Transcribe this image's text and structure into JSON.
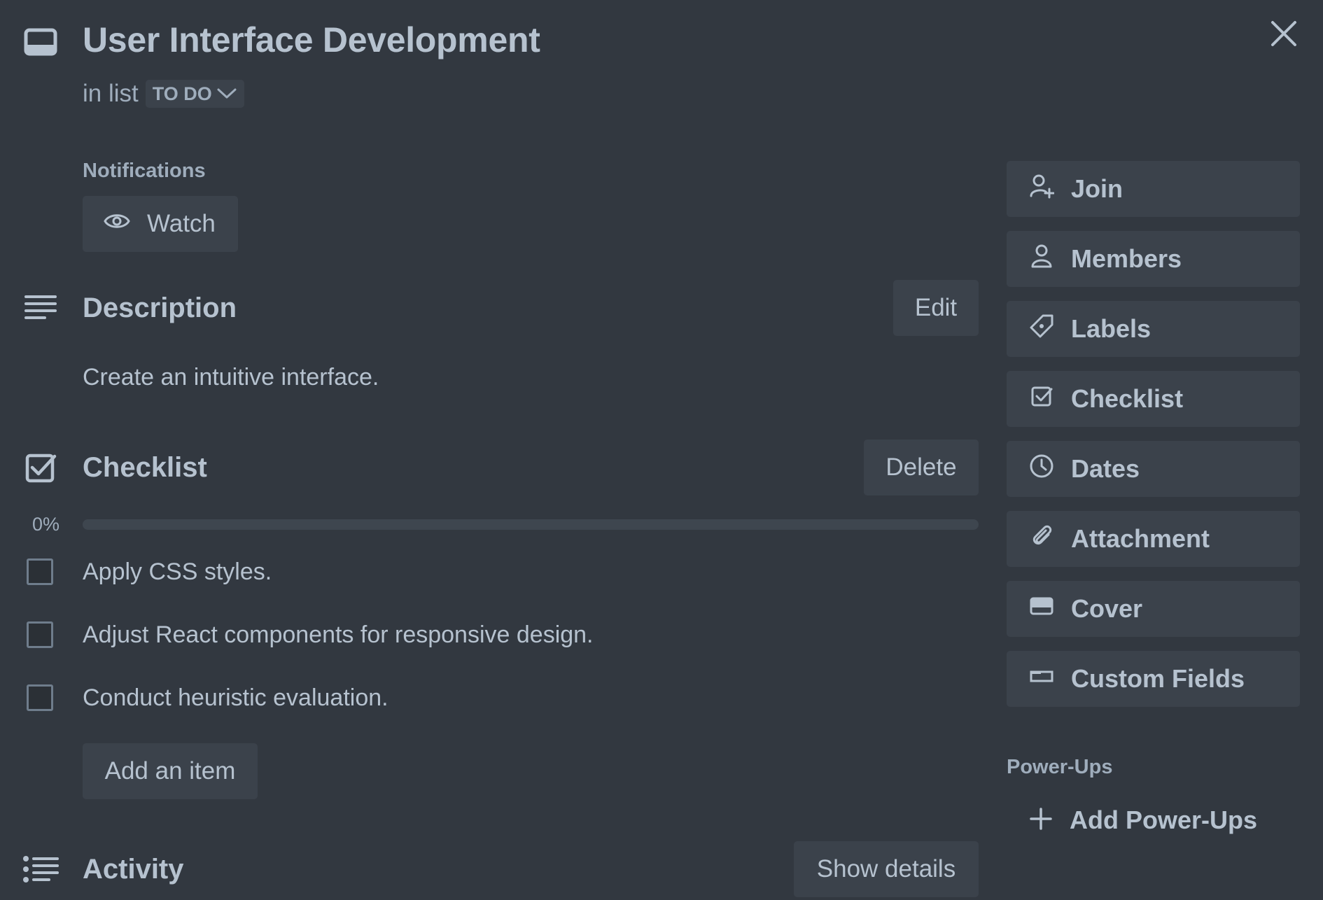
{
  "card": {
    "title": "User Interface Development",
    "in_list_prefix": "in list",
    "list_name": "TO DO"
  },
  "notifications": {
    "label": "Notifications",
    "watch_label": "Watch"
  },
  "description": {
    "title": "Description",
    "edit_label": "Edit",
    "text": "Create an intuitive interface."
  },
  "checklist": {
    "title": "Checklist",
    "delete_label": "Delete",
    "progress_text": "0%",
    "progress": 0,
    "items": [
      {
        "text": "Apply CSS styles.",
        "checked": false
      },
      {
        "text": "Adjust React components for responsive design.",
        "checked": false
      },
      {
        "text": "Conduct heuristic evaluation.",
        "checked": false
      }
    ],
    "add_item_label": "Add an item"
  },
  "activity": {
    "title": "Activity",
    "show_details_label": "Show details"
  },
  "sidebar": {
    "buttons": [
      {
        "label": "Join",
        "icon": "user-plus-icon"
      },
      {
        "label": "Members",
        "icon": "user-icon"
      },
      {
        "label": "Labels",
        "icon": "tag-icon"
      },
      {
        "label": "Checklist",
        "icon": "checklist-icon"
      },
      {
        "label": "Dates",
        "icon": "clock-icon"
      },
      {
        "label": "Attachment",
        "icon": "paperclip-icon"
      },
      {
        "label": "Cover",
        "icon": "cover-icon"
      },
      {
        "label": "Custom Fields",
        "icon": "custom-fields-icon"
      }
    ],
    "powerups_label": "Power-Ups",
    "add_powerups_label": "Add Power-Ups"
  },
  "colors": {
    "background": "#323840",
    "button": "#3b424b",
    "text": "#b6c2cf",
    "muted_text": "#9fadbc"
  }
}
